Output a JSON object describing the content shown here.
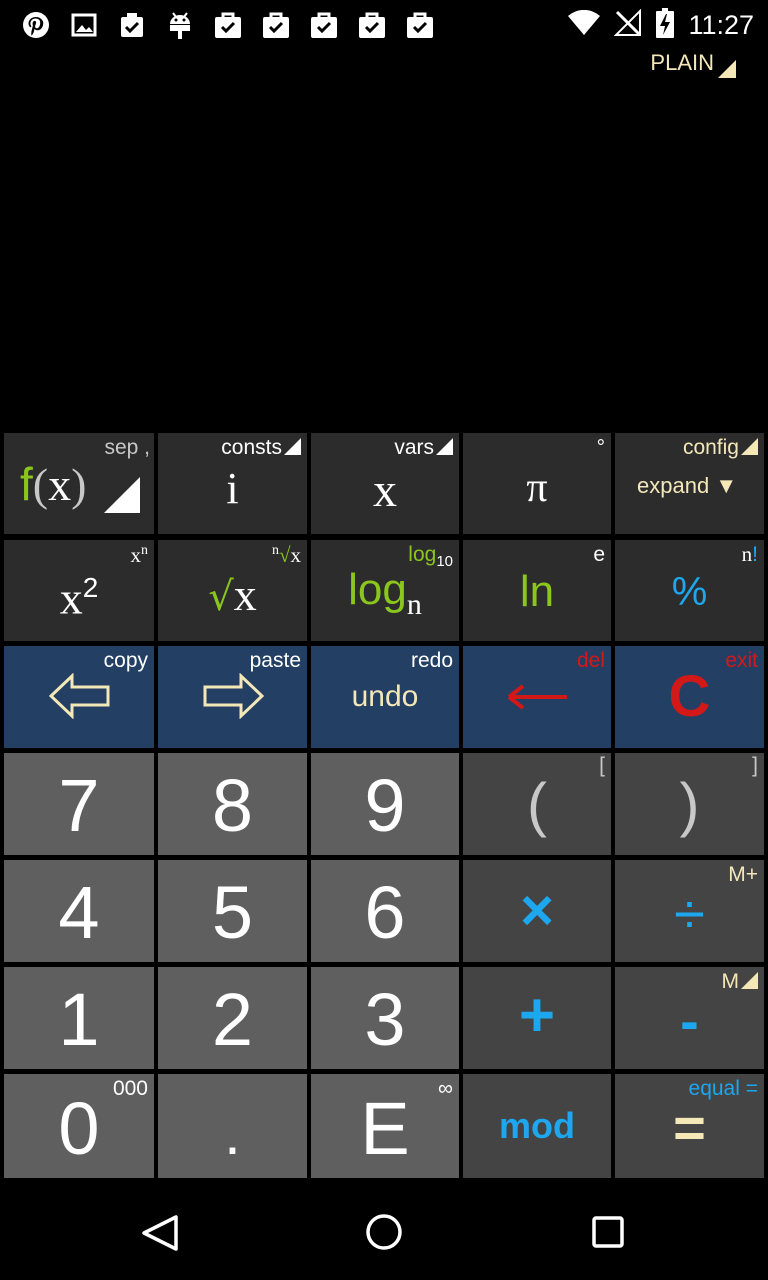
{
  "status_bar": {
    "time": "11:27",
    "left_icons": [
      "pinterest-icon",
      "image-icon",
      "clipboard-check-icon",
      "android-icon",
      "shopping-bag-icon",
      "shopping-bag-icon",
      "shopping-bag-icon",
      "shopping-bag-icon",
      "shopping-bag-icon"
    ],
    "right_icons": [
      "wifi-icon",
      "no-signal-icon",
      "battery-charging-icon"
    ]
  },
  "display": {
    "mode_label": "PLAIN"
  },
  "keypad": {
    "row1": {
      "fx": {
        "main_f": "f",
        "main_open": "(",
        "main_x": "x",
        "main_close": ")",
        "sub": "sep ,"
      },
      "i": {
        "main": "i",
        "sub": "consts"
      },
      "x": {
        "main": "x",
        "sub": "vars"
      },
      "pi": {
        "main": "π",
        "sub": "°"
      },
      "config": {
        "sub": "config",
        "main": "expand"
      }
    },
    "row2": {
      "square": {
        "main": "x",
        "exp": "2",
        "sub": "x",
        "sub_exp": "n"
      },
      "sqrt": {
        "main_root": "√",
        "main_x": "x",
        "sub_n": "n",
        "sub_root": "√",
        "sub_x": "x"
      },
      "log": {
        "main": "log",
        "main_base": "n",
        "sub": "log",
        "sub_base": "10"
      },
      "ln": {
        "main": "ln",
        "sub": "e"
      },
      "percent": {
        "main": "%",
        "sub_n": "n",
        "sub_bang": "!"
      }
    },
    "row3": {
      "left": {
        "sub": "copy"
      },
      "right": {
        "sub": "paste"
      },
      "undo": {
        "main": "undo",
        "sub": "redo"
      },
      "back": {
        "main": "←",
        "sub": "del"
      },
      "clear": {
        "main": "C",
        "sub": "exit"
      }
    },
    "row4": {
      "seven": "7",
      "eight": "8",
      "nine": "9",
      "lparen": "(",
      "lparen_sub": "[",
      "rparen": ")",
      "rparen_sub": "]"
    },
    "row5": {
      "four": "4",
      "five": "5",
      "six": "6",
      "mult": "×",
      "div": "÷",
      "div_sub": "M+"
    },
    "row6": {
      "one": "1",
      "two": "2",
      "three": "3",
      "plus": "+",
      "minus": "-",
      "minus_sub": "M"
    },
    "row7": {
      "zero": "0",
      "zero_sub": "000",
      "dot": ".",
      "e": "E",
      "e_sub": "∞",
      "mod": "mod",
      "equals": "=",
      "equals_sub": "equal ="
    }
  },
  "colors": {
    "green": "#8ac61d",
    "cyan": "#1ca7ef",
    "red": "#d31818",
    "cream": "#f4e7b8",
    "blue_key": "#233f63"
  },
  "nav_bar": {
    "icons": [
      "back-icon",
      "home-icon",
      "recents-icon"
    ]
  }
}
